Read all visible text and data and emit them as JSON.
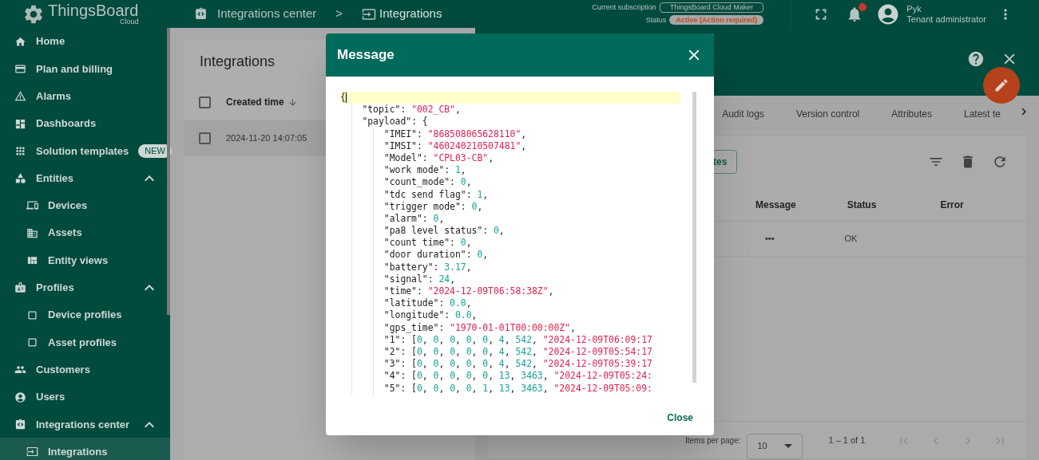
{
  "header": {
    "logo": {
      "name": "ThingsBoard",
      "edition": "Cloud"
    },
    "breadcrumbs": [
      {
        "label": "Integrations center"
      },
      {
        "label": "Integrations"
      }
    ],
    "separator": ">",
    "subscription": {
      "label": "Current subscription",
      "plan": "ThingsBoard Cloud Maker",
      "status_label": "Status",
      "status": "Active (Action required)"
    },
    "user": {
      "name": "Pyk",
      "role": "Tenant administrator"
    }
  },
  "sidebar": {
    "items": [
      {
        "label": "Home",
        "selected": false
      },
      {
        "label": "Plan and billing",
        "selected": false
      },
      {
        "label": "Alarms",
        "selected": false
      },
      {
        "label": "Dashboards",
        "selected": false
      },
      {
        "label": "Solution templates",
        "selected": false,
        "badge": "NEW"
      },
      {
        "label": "Entities",
        "selected": false,
        "expanded": true,
        "children": [
          {
            "label": "Devices",
            "selected": false
          },
          {
            "label": "Assets",
            "selected": false
          },
          {
            "label": "Entity views",
            "selected": false
          }
        ]
      },
      {
        "label": "Profiles",
        "selected": false,
        "expanded": true,
        "children": [
          {
            "label": "Device profiles",
            "selected": false
          },
          {
            "label": "Asset profiles",
            "selected": false
          }
        ]
      },
      {
        "label": "Customers",
        "selected": false
      },
      {
        "label": "Users",
        "selected": false
      },
      {
        "label": "Integrations center",
        "selected": false,
        "expanded": true,
        "children": [
          {
            "label": "Integrations",
            "selected": true
          }
        ]
      }
    ]
  },
  "integrations_list": {
    "title": "Integrations",
    "header_checked": false,
    "columns": [
      {
        "label": "Created time"
      }
    ],
    "rows": [
      {
        "created_time": "2024-11-20 14:07:05",
        "checked": false
      }
    ]
  },
  "details": {
    "tabs": [
      {
        "label": "Audit logs",
        "selected": false
      },
      {
        "label": "Version control",
        "selected": false
      },
      {
        "label": "Attributes",
        "selected": false
      },
      {
        "label": "Latest te",
        "selected": false
      }
    ],
    "events": {
      "button": "tes",
      "columns": [
        "Message",
        "Status",
        "Error"
      ],
      "rows": [
        {
          "message": "•••",
          "status": "OK"
        }
      ]
    },
    "paginator": {
      "label": "Items per page:",
      "page_size": "10",
      "range": "1 – 1 of 1"
    }
  },
  "modal": {
    "title": "Message",
    "close": "Close",
    "code": [
      {
        "text": "{",
        "active": true,
        "children": [
          {
            "text": "\"topic\": \"002_CB\",",
            "active": false
          },
          {
            "text": "\"payload\": {",
            "active": false,
            "children": [
              {
                "text": "\"IMEI\": \"868508065628110\",",
                "active": false
              },
              {
                "text": "\"IMSI\": \"460240210507481\",",
                "active": false
              },
              {
                "text": "\"Model\": \"CPL03-CB\",",
                "active": false
              },
              {
                "text": "\"work mode\": 1,",
                "active": false
              },
              {
                "text": "\"count_mode\": 0,",
                "active": false
              },
              {
                "text": "\"tdc send flag\": 1,",
                "active": false
              },
              {
                "text": "\"trigger mode\": 0,",
                "active": false
              },
              {
                "text": "\"alarm\": 0,",
                "active": false
              },
              {
                "text": "\"pa8 level status\": 0,",
                "active": false
              },
              {
                "text": "\"count time\": 0,",
                "active": false
              },
              {
                "text": "\"door duration\": 0,",
                "active": false
              },
              {
                "text": "\"battery\": 3.17,",
                "active": false
              },
              {
                "text": "\"signal\": 24,",
                "active": false
              },
              {
                "text": "\"time\": \"2024-12-09T06:58:38Z\",",
                "active": false
              },
              {
                "text": "\"latitude\": 0.0,",
                "active": false
              },
              {
                "text": "\"longitude\": 0.0,",
                "active": false
              },
              {
                "text": "\"gps_time\": \"1970-01-01T00:00:00Z\",",
                "active": false
              },
              {
                "text": "\"1\": [0, 0, 0, 0, 0, 4, 542, \"2024-12-09T06:09:17",
                "active": false
              },
              {
                "text": "\"2\": [0, 0, 0, 0, 0, 4, 542, \"2024-12-09T05:54:17",
                "active": false
              },
              {
                "text": "\"3\": [0, 0, 0, 0, 0, 4, 542, \"2024-12-09T05:39:17",
                "active": false
              },
              {
                "text": "\"4\": [0, 0, 0, 0, 0, 13, 3463, \"2024-12-09T05:24:",
                "active": false
              },
              {
                "text": "\"5\": [0, 0, 0, 0, 1, 13, 3463, \"2024-12-09T05:09:",
                "active": false
              }
            ]
          }
        ]
      }
    ]
  }
}
